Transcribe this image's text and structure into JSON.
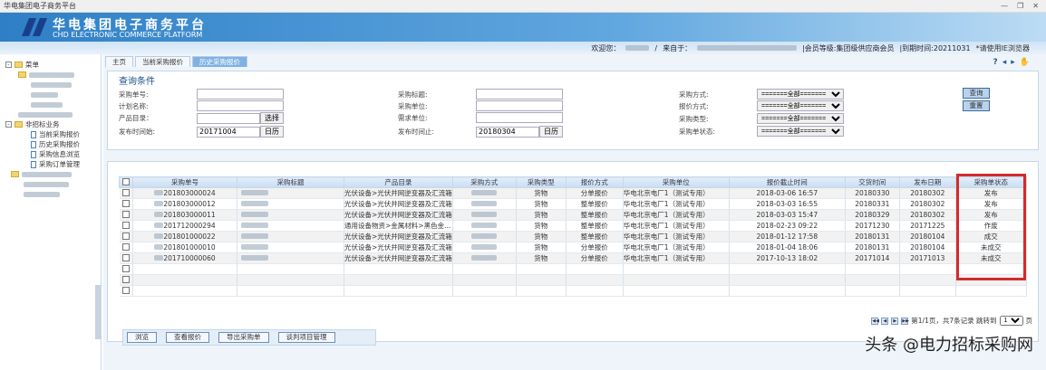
{
  "window": {
    "title": "华电集团电子商务平台",
    "controls": [
      "—",
      "❐",
      "✕"
    ]
  },
  "banner": {
    "title_cn": "华电集团电子商务平台",
    "title_en": "CHD ELECTRONIC COMMERCE PLATFORM"
  },
  "infobar": {
    "welcome": "欢迎您：",
    "sep": "/",
    "from": "来自于：",
    "member_level": "|会员等级:集团级供应商会员",
    "expire": "|到期时间:20211031",
    "ie_note": "*请使用IE浏览器"
  },
  "sidebar": {
    "root": "菜单",
    "group": "非招标业务",
    "items": [
      "当前采购报价",
      "历史采购报价",
      "采购信息浏览",
      "采购订单管理"
    ]
  },
  "tabs": [
    "主页",
    "当前采购报价",
    "历史采购报价"
  ],
  "tools": [
    "?",
    "◂",
    "▸",
    "✋"
  ],
  "query": {
    "title": "查询条件",
    "fields": {
      "order_no": "采购单号:",
      "plan_name": "计划名称:",
      "catalog": "产品目录：",
      "start": "发布时间始:",
      "title": "采购标题:",
      "unit": "采购单位:",
      "demand_unit": "需求单位:",
      "end": "发布时间止:",
      "method": "采购方式:",
      "quote_method": "报价方式:",
      "type": "采购类型:",
      "status": "采购单状态:"
    },
    "values": {
      "start": "20171004",
      "end": "20180304"
    },
    "select_all": "=======全部=======",
    "choose": "选择",
    "calendar": "日历",
    "search": "查询",
    "reset": "重置"
  },
  "grid": {
    "columns": [
      "采购单号",
      "采购标题",
      "产品目录",
      "采购方式",
      "采购类型",
      "报价方式",
      "采购单位",
      "报价截止时间",
      "交货时间",
      "发布日期",
      "采购单状态"
    ],
    "rows": [
      [
        "201803000024",
        "光伏设备>光伏并网逆变器及汇流箱",
        "货物",
        "分单报价",
        "华电北京电厂1（测试专用）",
        "2018-03-06 16:57",
        "20180330",
        "20180302",
        "发布"
      ],
      [
        "201803000012",
        "光伏设备>光伏并网逆变器及汇流箱",
        "货物",
        "整单报价",
        "华电北京电厂1（测试专用）",
        "2018-03-03 16:55",
        "20180331",
        "20180302",
        "发布"
      ],
      [
        "201803000011",
        "光伏设备>光伏并网逆变器及汇流箱",
        "货物",
        "整单报价",
        "华电北京电厂1（测试专用）",
        "2018-03-03 15:47",
        "20180329",
        "20180302",
        "发布"
      ],
      [
        "201712000294",
        "通用设备物资>金属材料>黑色金...",
        "货物",
        "整单报价",
        "华电北京电厂1（测试专用）",
        "2018-02-23 09:22",
        "20171230",
        "20171225",
        "作废"
      ],
      [
        "201801000022",
        "光伏设备>光伏并网逆变器及汇流箱",
        "货物",
        "整单报价",
        "华电北京电厂1（测试专用）",
        "2018-01-12 17:58",
        "20180131",
        "20180104",
        "成交"
      ],
      [
        "201801000010",
        "光伏设备>光伏并网逆变器及汇流箱",
        "货物",
        "分单报价",
        "华电北京电厂1（测试专用）",
        "2018-01-04 18:06",
        "20180131",
        "20180104",
        "未成交"
      ],
      [
        "201710000060",
        "光伏设备>光伏并网逆变器及汇流箱",
        "货物",
        "分单报价",
        "华电北京电厂1（测试专用）",
        "2017-10-13 18:02",
        "20171014",
        "20171013",
        "未成交"
      ]
    ],
    "pager": {
      "info": "第1/1页，共7条记录 跳转到",
      "page": "1",
      "suffix": "页"
    },
    "actions": [
      "浏览",
      "查看报价",
      "导出采购单",
      "谈判项目管理"
    ]
  },
  "watermark": "头条 @电力招标采购网",
  "colors": {
    "banner": "#2e7fc6",
    "highlight": "#d32b2b"
  }
}
